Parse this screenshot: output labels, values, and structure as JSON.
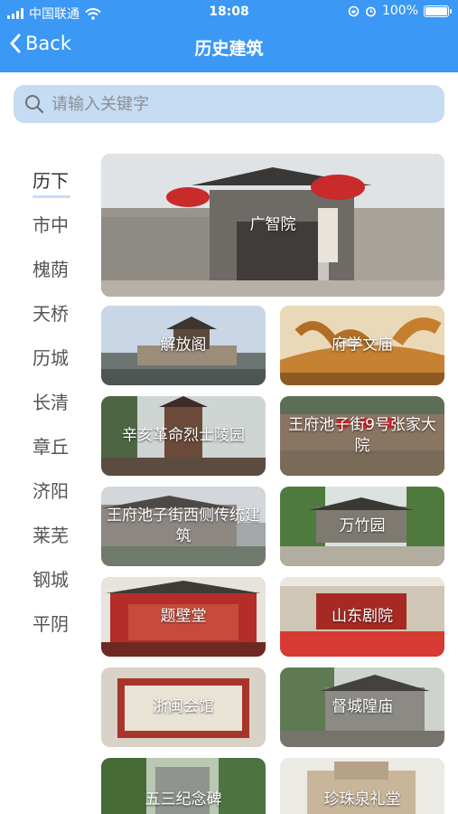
{
  "status_bar": {
    "carrier": "中国联通",
    "time": "18:08",
    "battery": "100%",
    "battery_level": 1.0
  },
  "nav": {
    "back_label": "Back",
    "title": "历史建筑"
  },
  "search": {
    "placeholder": "请输入关键字",
    "value": ""
  },
  "districts": [
    "历下",
    "市中",
    "槐荫",
    "天桥",
    "历城",
    "长清",
    "章丘",
    "济阳",
    "莱芜",
    "钢城",
    "平阴"
  ],
  "selected_district": "历下",
  "buildings": [
    {
      "name": "广智院"
    },
    {
      "name": "解放阁"
    },
    {
      "name": "府学文庙"
    },
    {
      "name": "辛亥革命烈士陵园"
    },
    {
      "name": "王府池子街9号张家大院"
    },
    {
      "name": "王府池子街西侧传统建筑"
    },
    {
      "name": "万竹园"
    },
    {
      "name": "题壁堂"
    },
    {
      "name": "山东剧院"
    },
    {
      "name": "浙闽会馆"
    },
    {
      "name": "督城隍庙"
    },
    {
      "name": "五三纪念碑"
    },
    {
      "name": "珍珠泉礼堂"
    }
  ],
  "colors": {
    "header": "#3b98f5",
    "search_bg": "#c6dcf3",
    "active_underline": "#c5dcf3"
  }
}
